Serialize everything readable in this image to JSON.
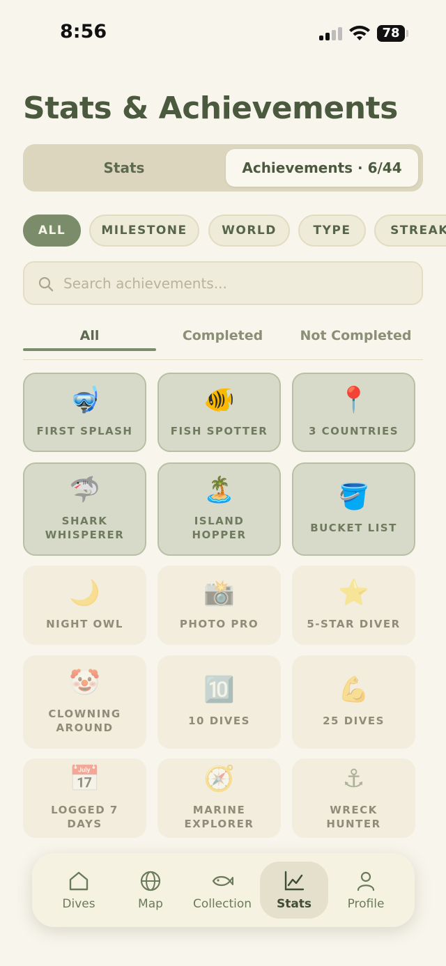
{
  "status_bar": {
    "time": "8:56",
    "battery": "78"
  },
  "page_title": "Stats & Achievements",
  "segments": {
    "stats": "Stats",
    "achievements": "Achievements · 6/44"
  },
  "categories": [
    "ALL",
    "MILESTONE",
    "WORLD",
    "TYPE",
    "STREAK"
  ],
  "active_category": "ALL",
  "search": {
    "placeholder": "Search achievements...",
    "value": ""
  },
  "filter_tabs": {
    "all": "All",
    "completed": "Completed",
    "not_completed": "Not Completed",
    "active": "All"
  },
  "achievements": [
    {
      "emoji": "🤿",
      "label": "FIRST SPLASH",
      "completed": true
    },
    {
      "emoji": "🐠",
      "label": "FISH SPOTTER",
      "completed": true
    },
    {
      "emoji": "📍",
      "label": "3 COUNTRIES",
      "completed": true
    },
    {
      "emoji": "🦈",
      "label": "SHARK WHISPERER",
      "completed": true
    },
    {
      "emoji": "🏝️",
      "label": "ISLAND HOPPER",
      "completed": true
    },
    {
      "emoji": "🪣",
      "label": "BUCKET LIST",
      "completed": true
    },
    {
      "emoji": "🌙",
      "label": "NIGHT OWL",
      "completed": false
    },
    {
      "emoji": "📸",
      "label": "PHOTO PRO",
      "completed": false
    },
    {
      "emoji": "⭐",
      "label": "5-STAR DIVER",
      "completed": false
    },
    {
      "emoji": "🤡",
      "label": "CLOWNING AROUND",
      "completed": false
    },
    {
      "emoji": "🔟",
      "label": "10 DIVES",
      "completed": false
    },
    {
      "emoji": "💪",
      "label": "25 DIVES",
      "completed": false
    },
    {
      "emoji": "📅",
      "label": "LOGGED 7 DAYS",
      "completed": false
    },
    {
      "emoji": "🧭",
      "label": "MARINE EXPLORER",
      "completed": false
    },
    {
      "emoji": "⚓",
      "label": "WRECK HUNTER",
      "completed": false
    }
  ],
  "tab_bar": {
    "items": [
      {
        "label": "Dives",
        "icon": "house-icon"
      },
      {
        "label": "Map",
        "icon": "globe-icon"
      },
      {
        "label": "Collection",
        "icon": "fish-icon"
      },
      {
        "label": "Stats",
        "icon": "chart-line-icon"
      },
      {
        "label": "Profile",
        "icon": "person-icon"
      }
    ],
    "active": "Stats"
  },
  "colors": {
    "accent": "#7b8c6a",
    "title": "#4b5a3f",
    "background": "#f8f6ec"
  }
}
